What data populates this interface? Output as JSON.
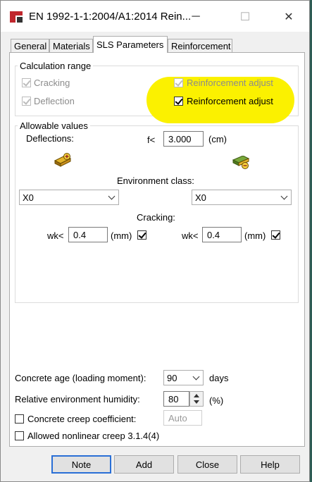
{
  "window": {
    "title": "EN 1992-1-1:2004/A1:2014 Rein..."
  },
  "titlebar": {
    "minimize_glyph": "─",
    "maximize_glyph": "☐",
    "close_glyph": "✕"
  },
  "tabs": [
    {
      "label": "General"
    },
    {
      "label": "Materials"
    },
    {
      "label": "SLS Parameters",
      "active": true
    },
    {
      "label": "Reinforcement"
    }
  ],
  "calc_range": {
    "legend": "Calculation range",
    "cracking": {
      "label": "Cracking",
      "checked": true,
      "enabled": false
    },
    "deflection": {
      "label": "Deflection",
      "checked": true,
      "enabled": false
    },
    "reinf_adjust_1": {
      "label": "Reinforcement adjust",
      "checked": true,
      "enabled": false
    },
    "reinf_adjust_2": {
      "label": "Reinforcement adjust",
      "checked": true,
      "enabled": true
    }
  },
  "allowable": {
    "legend": "Allowable values",
    "deflections_label": "Deflections:",
    "f_label": "f<",
    "f_value": "3.000",
    "f_unit": "(cm)",
    "env_class_label": "Environment class:",
    "env_left": "X0",
    "env_right": "X0",
    "cracking_label": "Cracking:",
    "wk_label": "wk<",
    "wk_left": "0.4",
    "wk_right": "0.4",
    "wk_unit": "(mm)"
  },
  "bottom": {
    "concrete_age_label": "Concrete age (loading moment):",
    "concrete_age_value": "90",
    "concrete_age_unit": "days",
    "humidity_label": "Relative environment humidity:",
    "humidity_value": "80",
    "humidity_unit": "(%)",
    "creep_coef_label": "Concrete creep coefficient:",
    "creep_coef_placeholder": "Auto",
    "nonlinear_label": "Allowed nonlinear creep 3.1.4(4)"
  },
  "buttons": {
    "note": "Note",
    "add": "Add",
    "close": "Close",
    "help": "Help"
  },
  "colors": {
    "highlight": "#fbf100",
    "accent": "#2a6fd6"
  }
}
